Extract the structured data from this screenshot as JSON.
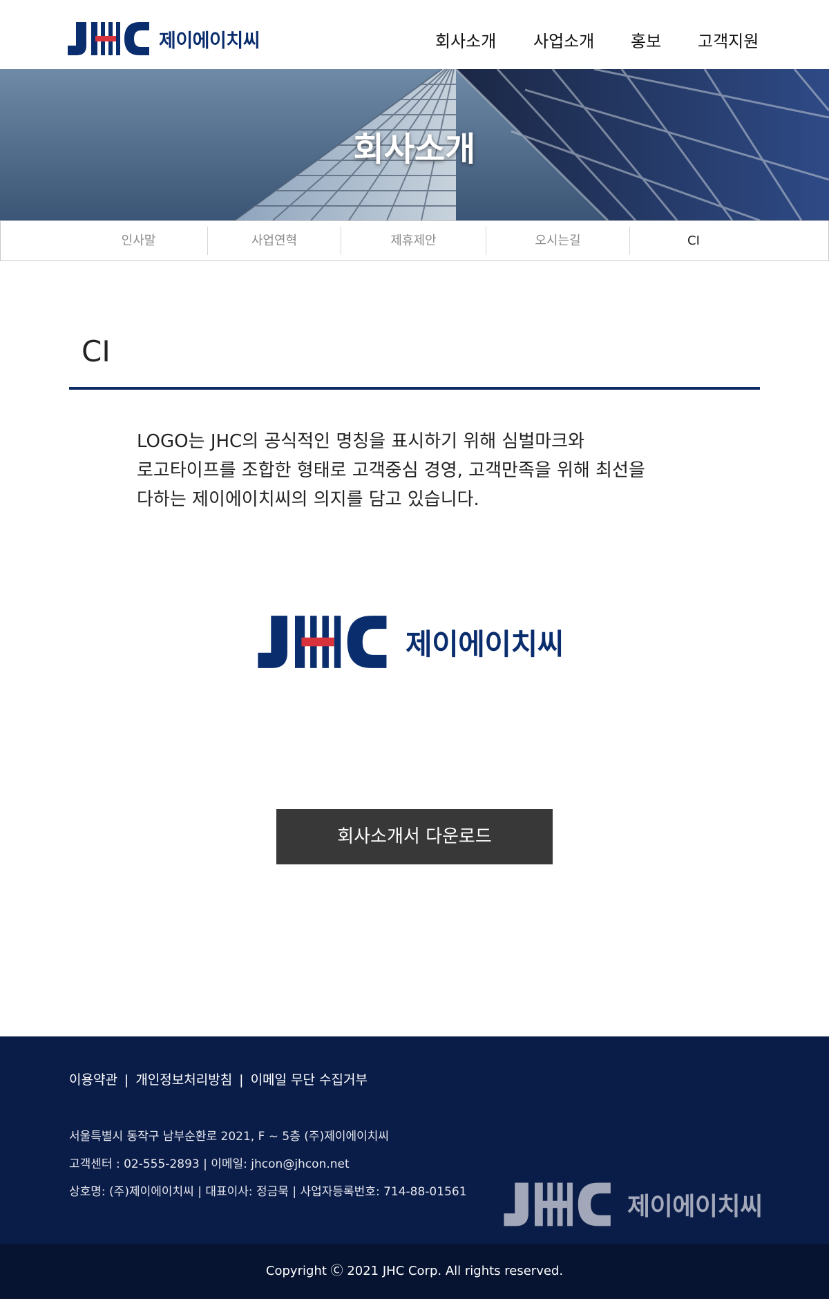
{
  "header": {
    "logo_letters": "JHC",
    "logo_name": "제이에이치씨",
    "nav": [
      "회사소개",
      "사업소개",
      "홍보",
      "고객지원"
    ]
  },
  "hero": {
    "title": "회사소개"
  },
  "subtabs": {
    "items": [
      "인사말",
      "사업연혁",
      "제휴제안",
      "오시는길",
      "CI"
    ],
    "active": "CI"
  },
  "content": {
    "title": "CI",
    "description": [
      "LOGO는 JHC의 공식적인 명칭을 표시하기 위해 심벌마크와",
      "로고타이프를 조합한 형태로 고객중심 경영, 고객만족을 위해 최선을",
      "다하는 제이에이치씨의 의지를 담고 있습니다."
    ],
    "download_label": "회사소개서 다운로드"
  },
  "footer": {
    "links": [
      "이용약관",
      "개인정보처리방침",
      "이메일 무단 수집거부"
    ],
    "address": "서울특별시 동작구 남부순환로 2021, F ~ 5층 (주)제이에이치씨",
    "contact": "고객센터 : 02-555-2893  |  이메일: jhcon@jhcon.net",
    "company": "상호명: (주)제이에이치씨  |  대표이사: 정금묵  |  사업자등록번호: 714-88-01561",
    "copyright": "Copyright Ⓒ 2021 JHC Corp. All rights reserved."
  },
  "colors": {
    "brand_navy": "#0a2d6e",
    "brand_red": "#d8333c",
    "footer_bg": "#0a1c48",
    "button_bg": "#383838"
  }
}
